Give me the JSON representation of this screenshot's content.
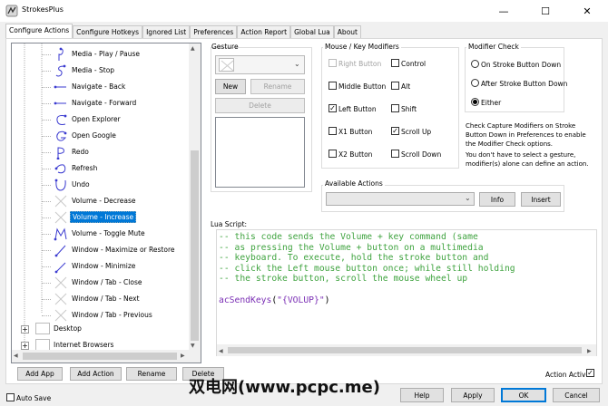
{
  "window": {
    "title": "StrokesPlus",
    "minimize_glyph": "—",
    "maximize_glyph": "☐",
    "close_glyph": "✕"
  },
  "tabs": [
    "Configure Actions",
    "Configure Hotkeys",
    "Ignored List",
    "Preferences",
    "Action Report",
    "Global Lua",
    "About"
  ],
  "tree": {
    "items": [
      {
        "label": "Media - Play / Pause",
        "icon": "gesture-stroke-icon"
      },
      {
        "label": "Media - Stop",
        "icon": "gesture-stroke-icon"
      },
      {
        "label": "Navigate - Back",
        "icon": "gesture-stroke-icon"
      },
      {
        "label": "Navigate - Forward",
        "icon": "gesture-stroke-icon"
      },
      {
        "label": "Open Explorer",
        "icon": "gesture-stroke-icon"
      },
      {
        "label": "Open Google",
        "icon": "gesture-stroke-icon"
      },
      {
        "label": "Redo",
        "icon": "gesture-stroke-icon"
      },
      {
        "label": "Refresh",
        "icon": "gesture-stroke-icon"
      },
      {
        "label": "Undo",
        "icon": "gesture-stroke-icon"
      },
      {
        "label": "Volume - Decrease",
        "icon": "no-gesture-icon"
      },
      {
        "label": "Volume - Increase",
        "icon": "no-gesture-icon",
        "selected": true
      },
      {
        "label": "Volume - Toggle Mute",
        "icon": "gesture-stroke-icon"
      },
      {
        "label": "Window - Maximize or Restore",
        "icon": "gesture-stroke-icon"
      },
      {
        "label": "Window - Minimize",
        "icon": "gesture-stroke-icon"
      },
      {
        "label": "Window / Tab - Close",
        "icon": "no-gesture-icon"
      },
      {
        "label": "Window / Tab - Next",
        "icon": "no-gesture-icon"
      },
      {
        "label": "Window / Tab - Previous",
        "icon": "no-gesture-icon"
      }
    ],
    "groups": [
      {
        "label": "Desktop",
        "expander": "+"
      },
      {
        "label": "Internet Browsers",
        "expander": "+"
      }
    ]
  },
  "gesture": {
    "group_title": "Gesture",
    "new_label": "New",
    "rename_label": "Rename",
    "delete_label": "Delete"
  },
  "modifiers": {
    "group_title": "Mouse / Key Modifiers",
    "items": [
      {
        "label": "Right Button",
        "checked": false,
        "disabled": true
      },
      {
        "label": "Control",
        "checked": false
      },
      {
        "label": "Middle Button",
        "checked": false
      },
      {
        "label": "Alt",
        "checked": false
      },
      {
        "label": "Left Button",
        "checked": true
      },
      {
        "label": "Shift",
        "checked": false
      },
      {
        "label": "X1 Button",
        "checked": false
      },
      {
        "label": "Scroll Up",
        "checked": true
      },
      {
        "label": "X2 Button",
        "checked": false
      },
      {
        "label": "Scroll Down",
        "checked": false
      }
    ]
  },
  "modifier_check": {
    "group_title": "Modifier Check",
    "options": [
      {
        "label": "On Stroke Button Down",
        "selected": false
      },
      {
        "label": "After Stroke Button Down",
        "selected": false
      },
      {
        "label": "Either",
        "selected": true
      }
    ],
    "info1": "Check Capture Modifiers on Stroke Button Down in Preferences to enable the Modifier Check options.",
    "info2": "You don't have to select a gesture, modifier(s) alone can define an action."
  },
  "available_actions": {
    "group_title": "Available Actions",
    "selected_value": "",
    "info_label": "Info",
    "insert_label": "Insert"
  },
  "lua": {
    "label": "Lua Script:",
    "lines": [
      {
        "text": "-- this code sends the Volume + key command (same",
        "kind": "comment"
      },
      {
        "text": "-- as pressing the Volume + button on a multimedia",
        "kind": "comment"
      },
      {
        "text": "-- keyboard. To execute, hold the stroke button and",
        "kind": "comment"
      },
      {
        "text": "-- click the Left mouse button once; while still holding",
        "kind": "comment"
      },
      {
        "text": "-- the stroke button, scroll the mouse wheel up",
        "kind": "comment"
      },
      {
        "text": "",
        "kind": "blank"
      },
      {
        "text": "acSendKeys(\"{VOLUP}\")",
        "kind": "code"
      }
    ],
    "code_fn": "acSendKeys",
    "code_open": "(",
    "code_arg": "\"{VOLUP}\"",
    "code_close": ")"
  },
  "bottom": {
    "add_app": "Add App",
    "add_action": "Add Action",
    "rename": "Rename",
    "delete": "Delete",
    "action_active": "Action Active",
    "action_active_checked": true,
    "auto_save": "Auto Save",
    "auto_save_checked": false,
    "help": "Help",
    "apply": "Apply",
    "ok": "OK",
    "cancel": "Cancel"
  },
  "watermark": "双电网(www.pcpc.me)",
  "colors": {
    "accent": "#0078d7",
    "comment": "#3fa33f",
    "code": "#7b2fb5",
    "tree_icon": "#3a3ad0"
  }
}
